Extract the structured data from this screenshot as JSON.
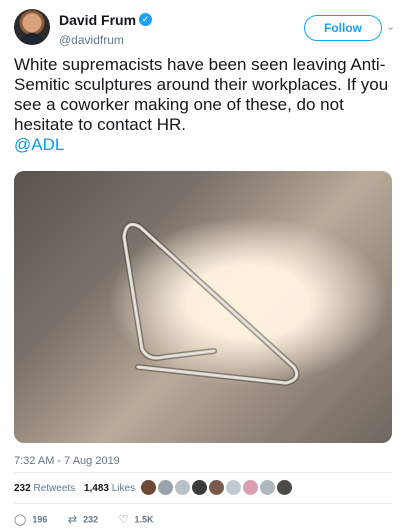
{
  "header": {
    "display_name": "David Frum",
    "handle": "@davidfrum",
    "verified_icon": "verified-badge-icon",
    "follow_label": "Follow",
    "caret_icon": "chevron-down-icon"
  },
  "tweet": {
    "text": "White supremacists have been seen leaving Anti-Semitic sculptures around their workplaces.  If you see a coworker making one of these, do not hesitate to contact HR.",
    "mention": "@ADL"
  },
  "media": {
    "subject": "bent paperclip"
  },
  "timestamp": "7:32 AM - 7 Aug 2019",
  "stats": {
    "retweets_count": "232",
    "retweets_label": "Retweets",
    "likes_count": "1,483",
    "likes_label": "Likes",
    "liker_colors": [
      "#6b4a35",
      "#9aa3ab",
      "#b9c1c8",
      "#3b3b3b",
      "#7a5a4a",
      "#c2c9cf",
      "#d9a0b0",
      "#b0b8bf",
      "#4a4a4a"
    ]
  },
  "actions": {
    "reply_count": "196",
    "retweet_count": "232",
    "like_count": "1.5K"
  },
  "colors": {
    "accent": "#1da1f2",
    "mention": "#1b95e0",
    "muted": "#657786"
  }
}
